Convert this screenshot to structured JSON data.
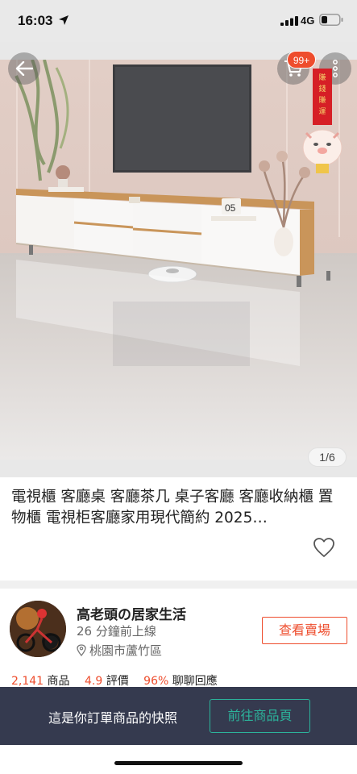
{
  "status_bar": {
    "time": "16:03",
    "network": "4G",
    "icons": [
      "location-arrow-icon",
      "signal-icon",
      "battery-icon"
    ]
  },
  "image_viewer": {
    "cart_badge": "99+",
    "counter": "1/6",
    "current_image": 1,
    "total_images": 6,
    "scene_text": "05",
    "promo_banner_text": "賺錢賺運"
  },
  "product": {
    "title": "電視櫃 客廳桌 客廳茶几 桌子客廳 客廳收納櫃 置物櫃 電視柜客廳家用現代簡約 2025…"
  },
  "shop": {
    "name": "高老頭の居家生活",
    "last_active": "26 分鐘前上線",
    "location": "桃園市蘆竹區",
    "view_shop_label": "查看賣場",
    "stats": [
      {
        "value": "2,141",
        "label": "商品"
      },
      {
        "value": "4.9",
        "label": "評價"
      },
      {
        "value": "96%",
        "label": "聊聊回應"
      }
    ]
  },
  "snapshot_banner": {
    "text": "這是你訂單商品的快照",
    "button_label": "前往商品頁"
  },
  "colors": {
    "accent": "#ee4d2d",
    "banner_bg": "#353a4f",
    "banner_button": "#2cb39b"
  }
}
